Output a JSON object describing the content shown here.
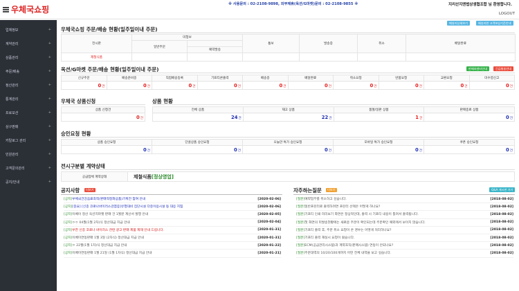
{
  "header": {
    "logo_text": "우체국쇼핑",
    "contact_text": "※ 사용문의 : 02-2108-9898,    외부제휴(옥션/G마켓)문의 : 02-2108-9855 ※",
    "welcome_text": "지리산지엔법상생협조합 님 환영합니다.",
    "logout_label": "LOGOUT"
  },
  "sidebar": {
    "items": [
      "업체정보",
      "계약관리",
      "상품관리",
      "주문/배송",
      "정산관리",
      "통계관리",
      "프로모션",
      "상구판매",
      "카탈로그 관리",
      "민원관리",
      "고객문의관리",
      "공지/안내"
    ]
  },
  "order_status": {
    "title": "우체국쇼핑 주문/배송 현황(일주일이내 주문)",
    "btn1": "매날리상세보기",
    "btn2": "배송지연 고객보상기준안내",
    "headers": {
      "exhibitor": "전시판",
      "ordered": "미청보",
      "normal": "일반주문",
      "reserved": "예약발송",
      "confirm": "통보",
      "shipping": "발송중",
      "cancel": "취소",
      "delivered": "배달완료"
    },
    "row_label": "제철식품"
  },
  "auction_status": {
    "title": "옥션/G마켓 주문/배송 현황(일주일이내 주문)",
    "btn1": "판매자센터안내",
    "btn2": "긴급발송안내",
    "headers": [
      "신규주문",
      "배송준비중",
      "직접배송등록",
      "기프티콘출력",
      "배송중",
      "배달완료",
      "취소요청",
      "반품요청",
      "교환요청",
      "미수령신고"
    ],
    "values": [
      "0",
      "0",
      "0",
      "0",
      "0",
      "0",
      "0",
      "0",
      "0",
      "0"
    ],
    "unit": "건"
  },
  "product_apply": {
    "title": "우체국 상품신청",
    "headers": [
      "상품 신청건"
    ],
    "values": [
      "0"
    ]
  },
  "product_status": {
    "title": "상품 현황",
    "headers": [
      "전체 상품",
      "재고 상품",
      "품절/일판 상품",
      "판매종료 상품"
    ],
    "values": [
      "24",
      "22",
      "1",
      "0"
    ]
  },
  "approval": {
    "title": "승인요청 현황",
    "headers": [
      "상품 승인요청",
      "단골상품 승인요청",
      "오늘만 특가 승인요청",
      "모바일 특가 승인요청",
      "쿠폰 승인요청"
    ],
    "values": [
      "0",
      "0",
      "0",
      "0",
      "0"
    ]
  },
  "contract": {
    "title": "전시구분별 계약상태",
    "label": "공급업체 계약상태",
    "value": "제철식품",
    "status": "[정상영업]"
  },
  "notices": {
    "title": "공지사항",
    "more": "더보기",
    "items": [
      {
        "tag": "[공지]",
        "text": "우체국건강음료최적(판매적정화상품)기획전 참여 안내",
        "date": "[2020-02-06]",
        "style": "blue"
      },
      {
        "tag": "[공지]",
        "text": "[중요] [신종 코로나바이러스감염증]유행대비 집단시설 다중이용시설 등 대응 지침",
        "date": "[2020-02-06]",
        "style": "blue"
      },
      {
        "tag": "[공지]",
        "text": "이베이 정산 옥션지마켓 판매 건 1월분 계산서 발행 안내",
        "date": "[2020-02-05]",
        "style": "normal"
      },
      {
        "tag": "[공지]",
        "text": "ㅇㅇ 04월(1월 2차)식 정산대금 지급 안내",
        "date": "[2020-02-04]",
        "style": "normal"
      },
      {
        "tag": "[공지]",
        "text": "우한 신종 코로나 바이러스 관련 광고 판매 제품 제재 안내 드립니다.",
        "date": "[2020-01-31]",
        "style": "red"
      },
      {
        "tag": "[공지]",
        "text": "이베이연동판매 1월 3일 (2차식) 정산대금 지급 안내",
        "date": "[2020-01-31]",
        "style": "normal"
      },
      {
        "tag": "[공지]",
        "text": "ㅇ 22월(1월 1차)식 정산대금 지급 안내",
        "date": "[2020-01-22]",
        "style": "normal"
      },
      {
        "tag": "[공지]",
        "text": "이베이연동판매 1월 21일 (1월 1차식) 정산대금 지급 안내",
        "date": "[2020-01-21]",
        "style": "normal"
      }
    ]
  },
  "faq": {
    "title": "자주하는질문",
    "more": "더보기",
    "qna_btn": "Q&A 게시판 가기",
    "items": [
      {
        "tag": "[질문]",
        "text": "예약업무를 취소하고 싶습니다.",
        "date": "[2018-08-02]"
      },
      {
        "tag": "[질문]",
        "text": "일반프린터로 출력하려면 프린터 선택은 어떻게 하나요?",
        "date": "[2018-08-02]"
      },
      {
        "tag": "[질문]",
        "text": "기프티 인쇄 미리보기 화면은 정상적인데, 출력 시 기프티 내용이 틀려서 출력됩니다.",
        "date": "[2018-08-02]"
      },
      {
        "tag": "[질문]",
        "text": "첫 화면의 미발송현황에는 새로운 주문이 확인되는데 주문확인 예외에서 보이지 않습니다.",
        "date": "[2018-08-02]"
      },
      {
        "tag": "[질문]",
        "text": "기프티 출력 후, 주문 취소 요청이 온 경우는 어떻게 처리하나요?",
        "date": "[2018-08-02]"
      },
      {
        "tag": "[질문]",
        "text": "기프티 출력 재실시 요청이 왔습니다.",
        "date": "[2018-08-02]"
      },
      {
        "tag": "[질문]",
        "text": "ECM(공급관리시스템)과 계약조직(판매시스템) 연동이 안되나요?",
        "date": "[2018-08-02]"
      },
      {
        "tag": "[질문]",
        "text": "주문대역의 10/20/100개까지 어떤 전체 내역을 보고 싶습니다.",
        "date": "[2018-08-02]"
      }
    ]
  },
  "colors": {
    "accent_blue": "#57b6e3",
    "green": "#36b24a",
    "red": "#e94b3c",
    "orange": "#f0a030",
    "sidebar_bg": "#2b3036",
    "teal": "#3ab5c9"
  }
}
